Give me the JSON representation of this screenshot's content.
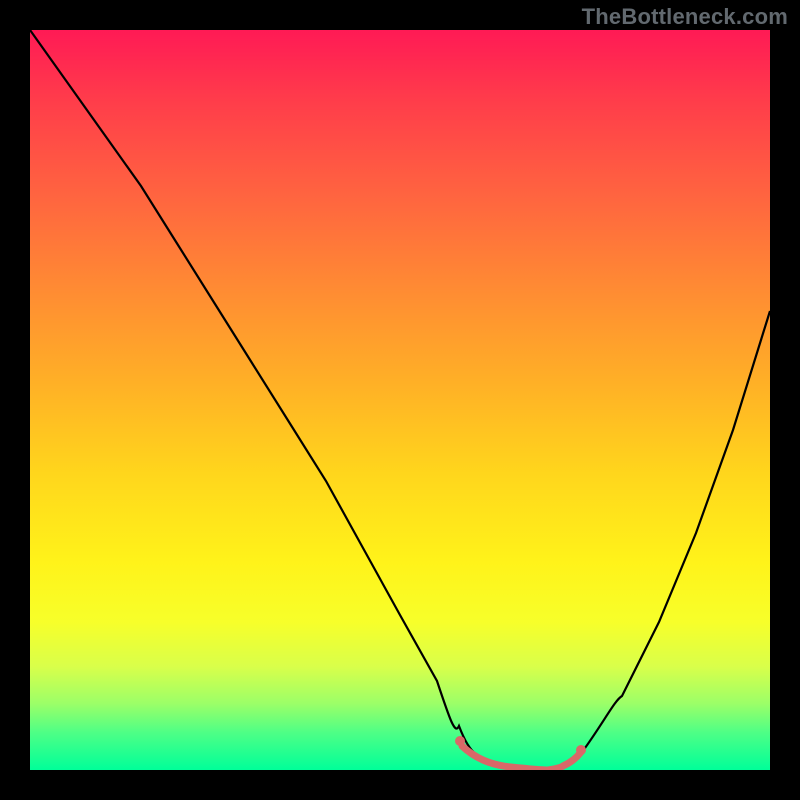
{
  "watermark": "TheBottleneck.com",
  "colors": {
    "background": "#000000",
    "curve": "#000000",
    "accent": "#d96868",
    "gradient_top": "#ff1a55",
    "gradient_bottom": "#00ff99",
    "watermark": "#62696f"
  },
  "chart_data": {
    "type": "line",
    "title": "",
    "xlabel": "",
    "ylabel": "",
    "xlim": [
      0,
      100
    ],
    "ylim": [
      0,
      100
    ],
    "grid": false,
    "legend": false,
    "gradient_background": "vertical red→yellow→green",
    "series": [
      {
        "name": "bottleneck-curve",
        "x": [
          0,
          5,
          10,
          15,
          20,
          25,
          30,
          35,
          40,
          45,
          50,
          55,
          58,
          60,
          65,
          70,
          72,
          75,
          80,
          85,
          90,
          95,
          100
        ],
        "values": [
          100,
          93,
          86,
          79,
          71,
          63,
          55,
          47,
          39,
          30,
          21,
          12,
          6,
          3,
          0.5,
          0,
          0.5,
          3,
          10,
          20,
          32,
          46,
          62
        ]
      }
    ],
    "accent_highlight": {
      "x_start": 58,
      "x_end": 72,
      "note": "flat valley segment highlighted with salmon stroke"
    }
  }
}
